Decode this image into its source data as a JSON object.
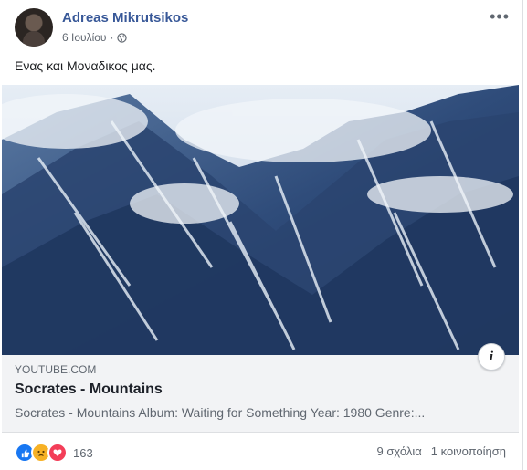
{
  "post": {
    "author": "Adreas Mikrutsikos",
    "date": "6 Ιουλίου",
    "separator": "·",
    "privacy_icon": "globe-icon",
    "more_label": "•••",
    "text": "Ενας και Μοναδικος μας."
  },
  "link_preview": {
    "domain": "YOUTUBE.COM",
    "title": "Socrates - Mountains",
    "description": "Socrates - Mountains Album: Waiting for Something Year: 1980 Genre:...",
    "info_label": "i"
  },
  "footer": {
    "reactions": [
      "like-icon",
      "sad-icon",
      "love-icon"
    ],
    "reaction_count": "163",
    "comments": "9 σχόλια",
    "shares": "1 κοινοποίηση"
  },
  "colors": {
    "name": "#385898",
    "like": "#1877f2",
    "love": "#f33e58",
    "sad": "#f7b125"
  }
}
